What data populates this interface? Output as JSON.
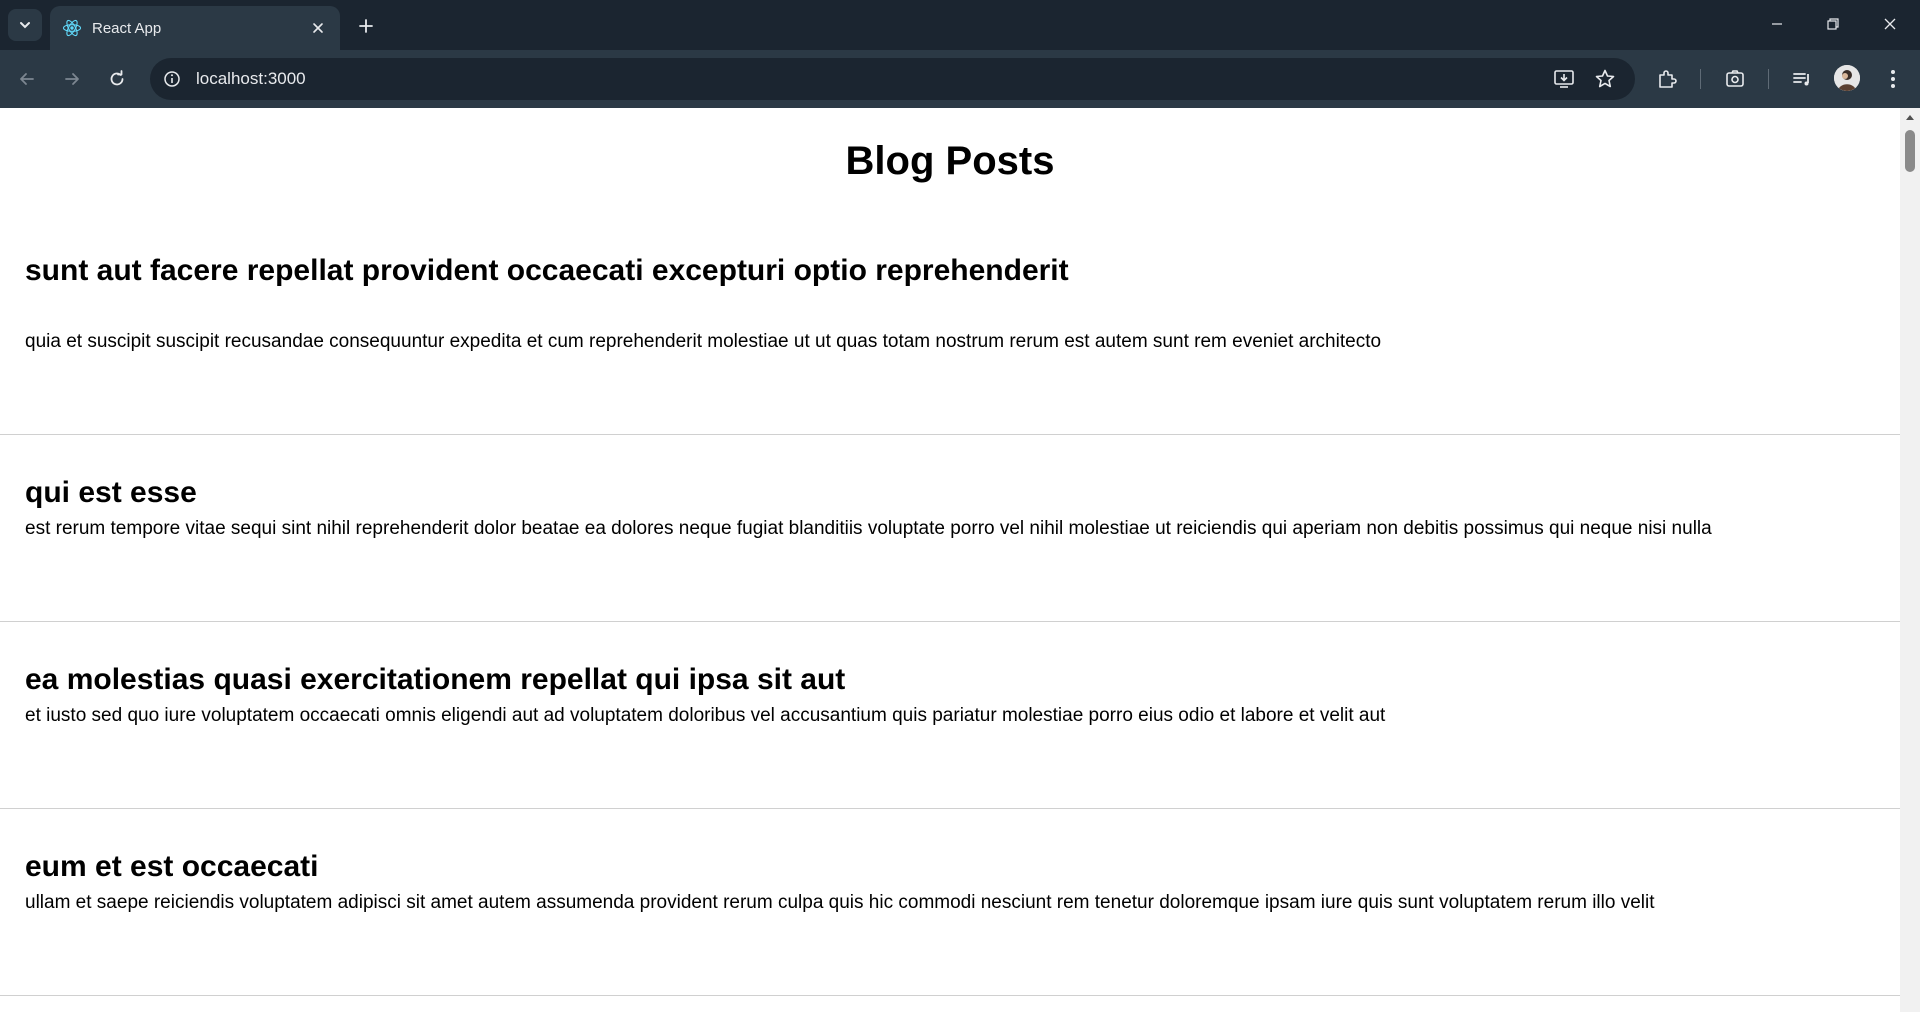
{
  "browser": {
    "tab_title": "React App",
    "url": "localhost:3000"
  },
  "page": {
    "title": "Blog Posts",
    "posts": [
      {
        "title": "sunt aut facere repellat provident occaecati excepturi optio reprehenderit",
        "body": "quia et suscipit suscipit recusandae consequuntur expedita et cum reprehenderit molestiae ut ut quas totam nostrum rerum est autem sunt rem eveniet architecto"
      },
      {
        "title": "qui est esse",
        "body": "est rerum tempore vitae sequi sint nihil reprehenderit dolor beatae ea dolores neque fugiat blanditiis voluptate porro vel nihil molestiae ut reiciendis qui aperiam non debitis possimus qui neque nisi nulla"
      },
      {
        "title": "ea molestias quasi exercitationem repellat qui ipsa sit aut",
        "body": "et iusto sed quo iure voluptatem occaecati omnis eligendi aut ad voluptatem doloribus vel accusantium quis pariatur molestiae porro eius odio et labore et velit aut"
      },
      {
        "title": "eum et est occaecati",
        "body": "ullam et saepe reiciendis voluptatem adipisci sit amet autem assumenda provident rerum culpa quis hic commodi nesciunt rem tenetur doloremque ipsam iure quis sunt voluptatem rerum illo velit"
      }
    ]
  },
  "colors": {
    "tabbar_bg": "#1b2530",
    "toolbar_bg": "#2b3945",
    "page_bg": "#ffffff",
    "divider": "#d0d0d0"
  },
  "icons": {
    "tab_search": "chevron-down-icon",
    "favicon": "react-logo-icon",
    "tab_close": "close-icon",
    "new_tab": "plus-icon",
    "back": "arrow-left-icon",
    "forward": "arrow-right-icon",
    "reload": "reload-icon",
    "site_info": "info-icon",
    "install": "install-app-icon",
    "bookmark": "star-icon",
    "extensions": "puzzle-icon",
    "screenshot": "camera-icon",
    "media": "media-queue-icon",
    "menu": "kebab-menu-icon"
  }
}
